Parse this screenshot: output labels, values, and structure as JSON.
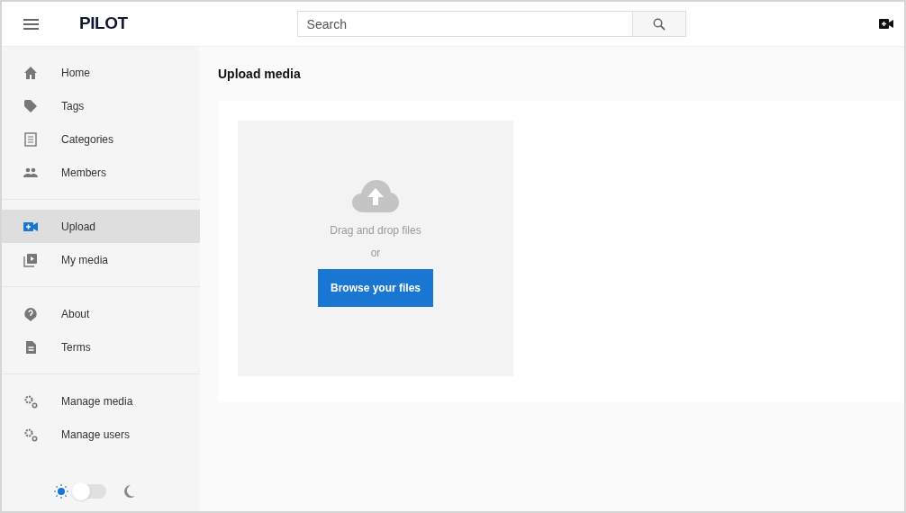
{
  "header": {
    "logo": "PILOT",
    "search": {
      "placeholder": "Search"
    }
  },
  "sidebar": {
    "groups": [
      {
        "items": [
          {
            "label": "Home",
            "selected": false
          },
          {
            "label": "Tags",
            "selected": false
          },
          {
            "label": "Categories",
            "selected": false
          },
          {
            "label": "Members",
            "selected": false
          }
        ]
      },
      {
        "items": [
          {
            "label": "Upload",
            "selected": true
          },
          {
            "label": "My media",
            "selected": false
          }
        ]
      },
      {
        "items": [
          {
            "label": "About",
            "selected": false
          },
          {
            "label": "Terms",
            "selected": false
          }
        ]
      },
      {
        "items": [
          {
            "label": "Manage media",
            "selected": false
          },
          {
            "label": "Manage users",
            "selected": false
          }
        ]
      }
    ],
    "theme_toggle": {
      "on": false
    }
  },
  "page": {
    "title": "Upload media",
    "dropzone": {
      "hint": "Drag and drop files",
      "separator": "or",
      "button": "Browse your files"
    }
  }
}
